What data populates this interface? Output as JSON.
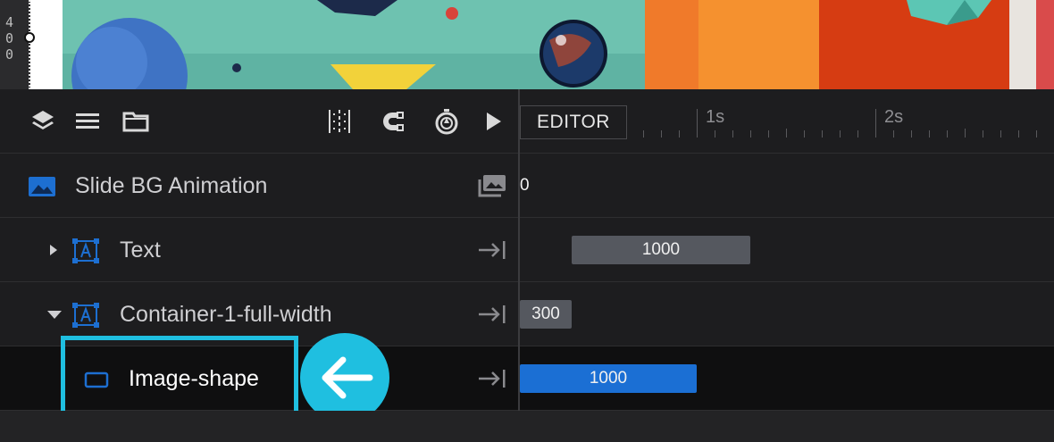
{
  "preview": {
    "ruler_numbers": [
      "4",
      "0",
      "0"
    ],
    "colors": {
      "teal": "#6ec2b0",
      "orange": "#f5912f",
      "red": "#d63c12",
      "blue_ball": "#3f73c4",
      "yellow": "#f2d23a"
    }
  },
  "toolbar": {
    "left_icons": [
      "layers-icon",
      "list-icon",
      "folder-icon"
    ],
    "right_icons": [
      "grid-dotted-icon",
      "magnet-icon",
      "stopwatch-icon",
      "play-icon"
    ]
  },
  "timeline": {
    "editor_label": "EDITOR",
    "marks": [
      "1s",
      "2s"
    ]
  },
  "layers": [
    {
      "name": "Slide BG Animation",
      "icon": "image-icon",
      "right_icon": "gallery-icon",
      "timeline_value": "0",
      "accent": "#1d6fd1"
    },
    {
      "name": "Text",
      "icon": "text-layer-icon",
      "right_icon": "arrow-to-end-icon",
      "timeline_value": "1000",
      "expanded": false
    },
    {
      "name": "Container-1-full-width",
      "icon": "text-layer-icon",
      "right_icon": "arrow-to-end-icon",
      "timeline_value": "300",
      "expanded": true
    },
    {
      "name": "Image-shape",
      "icon": "shape-layer-icon",
      "right_icon": "arrow-to-end-icon",
      "timeline_value": "1000",
      "selected": true
    }
  ],
  "colors": {
    "accent_blue": "#1b6fd4",
    "bar_gray": "#55585f",
    "highlight_cyan": "#1fbfe0"
  }
}
